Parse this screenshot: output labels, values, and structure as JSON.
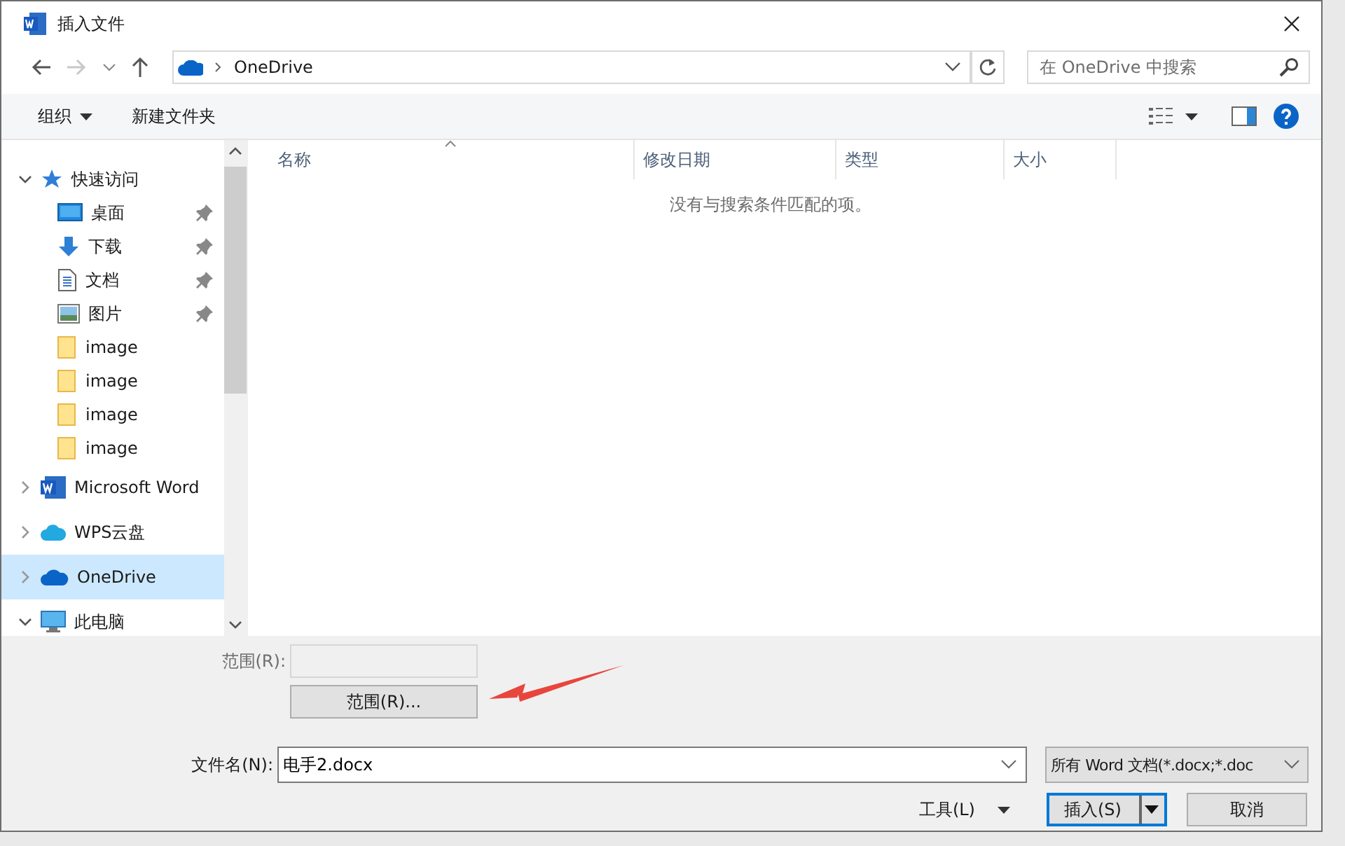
{
  "window": {
    "title": "插入文件"
  },
  "address": {
    "location": "OneDrive",
    "search_placeholder": "在 OneDrive 中搜索"
  },
  "toolbar": {
    "organize": "组织",
    "new_folder": "新建文件夹"
  },
  "nav": [
    {
      "label": "快速访问",
      "kind": "star",
      "expanded": true,
      "selected": false,
      "children": [
        {
          "label": "桌面",
          "kind": "desktop",
          "pinned": true
        },
        {
          "label": "下载",
          "kind": "download",
          "pinned": true
        },
        {
          "label": "文档",
          "kind": "document",
          "pinned": true
        },
        {
          "label": "图片",
          "kind": "pictures",
          "pinned": true
        },
        {
          "label": "image",
          "kind": "folder",
          "pinned": false
        },
        {
          "label": "image",
          "kind": "folder",
          "pinned": false
        },
        {
          "label": "image",
          "kind": "folder",
          "pinned": false
        },
        {
          "label": "image",
          "kind": "folder",
          "pinned": false
        }
      ]
    },
    {
      "label": "Microsoft Word",
      "kind": "word",
      "expanded": false,
      "selected": false
    },
    {
      "label": "WPS云盘",
      "kind": "cloudcyan",
      "expanded": false,
      "selected": false
    },
    {
      "label": "OneDrive",
      "kind": "cloud",
      "expanded": false,
      "selected": true
    },
    {
      "label": "此电脑",
      "kind": "computer",
      "expanded": true,
      "selected": false
    }
  ],
  "table": {
    "columns": [
      "名称",
      "修改日期",
      "类型",
      "大小"
    ],
    "empty_message": "没有与搜索条件匹配的项。"
  },
  "range": {
    "label": "范围(R):",
    "button": "范围(R)..."
  },
  "filename": {
    "label": "文件名(N):",
    "value": "电手2.docx"
  },
  "filetype": {
    "value": "所有 Word 文档(*.docx;*.doc"
  },
  "buttons": {
    "tools": "工具(L)",
    "insert": "插入(S)",
    "cancel": "取消"
  }
}
